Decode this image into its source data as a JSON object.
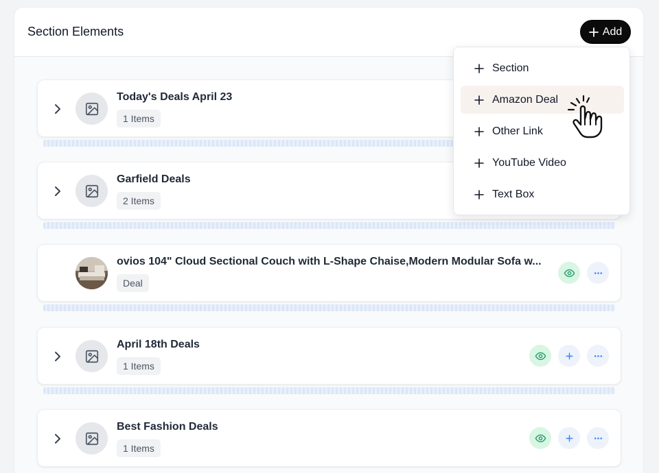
{
  "header": {
    "title": "Section Elements",
    "add_label": "Add"
  },
  "cards": [
    {
      "title": "Today's Deals April 23",
      "badge": "1 Items",
      "thumb": "image-placeholder"
    },
    {
      "title": "Garfield Deals",
      "badge": "2 Items",
      "thumb": "image-placeholder"
    },
    {
      "title": "ovios 104\" Cloud Sectional Couch with L-Shape Chaise,Modern Modular Sofa w...",
      "badge": "Deal",
      "thumb": "product-photo"
    },
    {
      "title": "April 18th Deals",
      "badge": "1 Items",
      "thumb": "image-placeholder"
    },
    {
      "title": "Best Fashion Deals",
      "badge": "1 Items",
      "thumb": "image-placeholder"
    }
  ],
  "menu": {
    "items": [
      {
        "label": "Section"
      },
      {
        "label": "Amazon Deal",
        "hovered": true
      },
      {
        "label": "Other Link"
      },
      {
        "label": "YouTube Video"
      },
      {
        "label": "Text Box"
      }
    ]
  },
  "icons": {
    "expand": "chevron-right-icon",
    "thumb": "image-icon",
    "visibility": "eye-icon",
    "add": "plus-icon",
    "more": "ellipsis-icon",
    "cursor": "hand-pointer-icon"
  },
  "colors": {
    "add_button": "#0b0b0b",
    "eye_bg": "#d9f5e3",
    "eye_icon": "#22a06b",
    "action_bg": "#edf2fb",
    "action_icon": "#3b82f6",
    "menu_hover": "#f8f2ef"
  }
}
